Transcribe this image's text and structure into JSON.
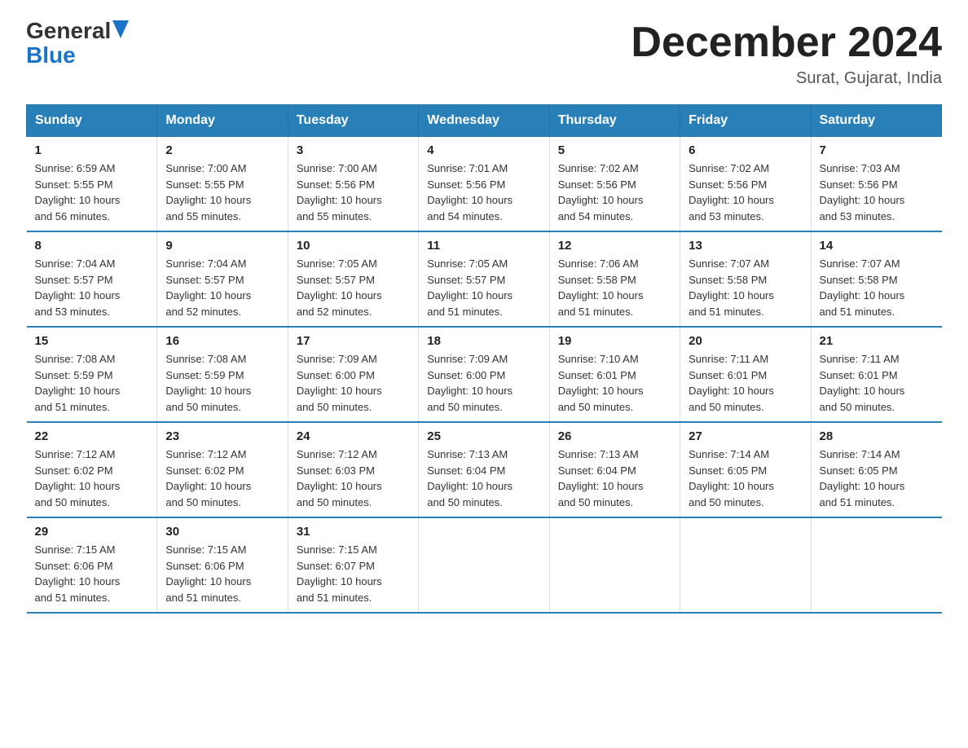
{
  "logo": {
    "general": "General",
    "blue": "Blue"
  },
  "title": "December 2024",
  "subtitle": "Surat, Gujarat, India",
  "days_of_week": [
    "Sunday",
    "Monday",
    "Tuesday",
    "Wednesday",
    "Thursday",
    "Friday",
    "Saturday"
  ],
  "weeks": [
    [
      {
        "day": "1",
        "info": "Sunrise: 6:59 AM\nSunset: 5:55 PM\nDaylight: 10 hours\nand 56 minutes."
      },
      {
        "day": "2",
        "info": "Sunrise: 7:00 AM\nSunset: 5:55 PM\nDaylight: 10 hours\nand 55 minutes."
      },
      {
        "day": "3",
        "info": "Sunrise: 7:00 AM\nSunset: 5:56 PM\nDaylight: 10 hours\nand 55 minutes."
      },
      {
        "day": "4",
        "info": "Sunrise: 7:01 AM\nSunset: 5:56 PM\nDaylight: 10 hours\nand 54 minutes."
      },
      {
        "day": "5",
        "info": "Sunrise: 7:02 AM\nSunset: 5:56 PM\nDaylight: 10 hours\nand 54 minutes."
      },
      {
        "day": "6",
        "info": "Sunrise: 7:02 AM\nSunset: 5:56 PM\nDaylight: 10 hours\nand 53 minutes."
      },
      {
        "day": "7",
        "info": "Sunrise: 7:03 AM\nSunset: 5:56 PM\nDaylight: 10 hours\nand 53 minutes."
      }
    ],
    [
      {
        "day": "8",
        "info": "Sunrise: 7:04 AM\nSunset: 5:57 PM\nDaylight: 10 hours\nand 53 minutes."
      },
      {
        "day": "9",
        "info": "Sunrise: 7:04 AM\nSunset: 5:57 PM\nDaylight: 10 hours\nand 52 minutes."
      },
      {
        "day": "10",
        "info": "Sunrise: 7:05 AM\nSunset: 5:57 PM\nDaylight: 10 hours\nand 52 minutes."
      },
      {
        "day": "11",
        "info": "Sunrise: 7:05 AM\nSunset: 5:57 PM\nDaylight: 10 hours\nand 51 minutes."
      },
      {
        "day": "12",
        "info": "Sunrise: 7:06 AM\nSunset: 5:58 PM\nDaylight: 10 hours\nand 51 minutes."
      },
      {
        "day": "13",
        "info": "Sunrise: 7:07 AM\nSunset: 5:58 PM\nDaylight: 10 hours\nand 51 minutes."
      },
      {
        "day": "14",
        "info": "Sunrise: 7:07 AM\nSunset: 5:58 PM\nDaylight: 10 hours\nand 51 minutes."
      }
    ],
    [
      {
        "day": "15",
        "info": "Sunrise: 7:08 AM\nSunset: 5:59 PM\nDaylight: 10 hours\nand 51 minutes."
      },
      {
        "day": "16",
        "info": "Sunrise: 7:08 AM\nSunset: 5:59 PM\nDaylight: 10 hours\nand 50 minutes."
      },
      {
        "day": "17",
        "info": "Sunrise: 7:09 AM\nSunset: 6:00 PM\nDaylight: 10 hours\nand 50 minutes."
      },
      {
        "day": "18",
        "info": "Sunrise: 7:09 AM\nSunset: 6:00 PM\nDaylight: 10 hours\nand 50 minutes."
      },
      {
        "day": "19",
        "info": "Sunrise: 7:10 AM\nSunset: 6:01 PM\nDaylight: 10 hours\nand 50 minutes."
      },
      {
        "day": "20",
        "info": "Sunrise: 7:11 AM\nSunset: 6:01 PM\nDaylight: 10 hours\nand 50 minutes."
      },
      {
        "day": "21",
        "info": "Sunrise: 7:11 AM\nSunset: 6:01 PM\nDaylight: 10 hours\nand 50 minutes."
      }
    ],
    [
      {
        "day": "22",
        "info": "Sunrise: 7:12 AM\nSunset: 6:02 PM\nDaylight: 10 hours\nand 50 minutes."
      },
      {
        "day": "23",
        "info": "Sunrise: 7:12 AM\nSunset: 6:02 PM\nDaylight: 10 hours\nand 50 minutes."
      },
      {
        "day": "24",
        "info": "Sunrise: 7:12 AM\nSunset: 6:03 PM\nDaylight: 10 hours\nand 50 minutes."
      },
      {
        "day": "25",
        "info": "Sunrise: 7:13 AM\nSunset: 6:04 PM\nDaylight: 10 hours\nand 50 minutes."
      },
      {
        "day": "26",
        "info": "Sunrise: 7:13 AM\nSunset: 6:04 PM\nDaylight: 10 hours\nand 50 minutes."
      },
      {
        "day": "27",
        "info": "Sunrise: 7:14 AM\nSunset: 6:05 PM\nDaylight: 10 hours\nand 50 minutes."
      },
      {
        "day": "28",
        "info": "Sunrise: 7:14 AM\nSunset: 6:05 PM\nDaylight: 10 hours\nand 51 minutes."
      }
    ],
    [
      {
        "day": "29",
        "info": "Sunrise: 7:15 AM\nSunset: 6:06 PM\nDaylight: 10 hours\nand 51 minutes."
      },
      {
        "day": "30",
        "info": "Sunrise: 7:15 AM\nSunset: 6:06 PM\nDaylight: 10 hours\nand 51 minutes."
      },
      {
        "day": "31",
        "info": "Sunrise: 7:15 AM\nSunset: 6:07 PM\nDaylight: 10 hours\nand 51 minutes."
      },
      {
        "day": "",
        "info": ""
      },
      {
        "day": "",
        "info": ""
      },
      {
        "day": "",
        "info": ""
      },
      {
        "day": "",
        "info": ""
      }
    ]
  ]
}
